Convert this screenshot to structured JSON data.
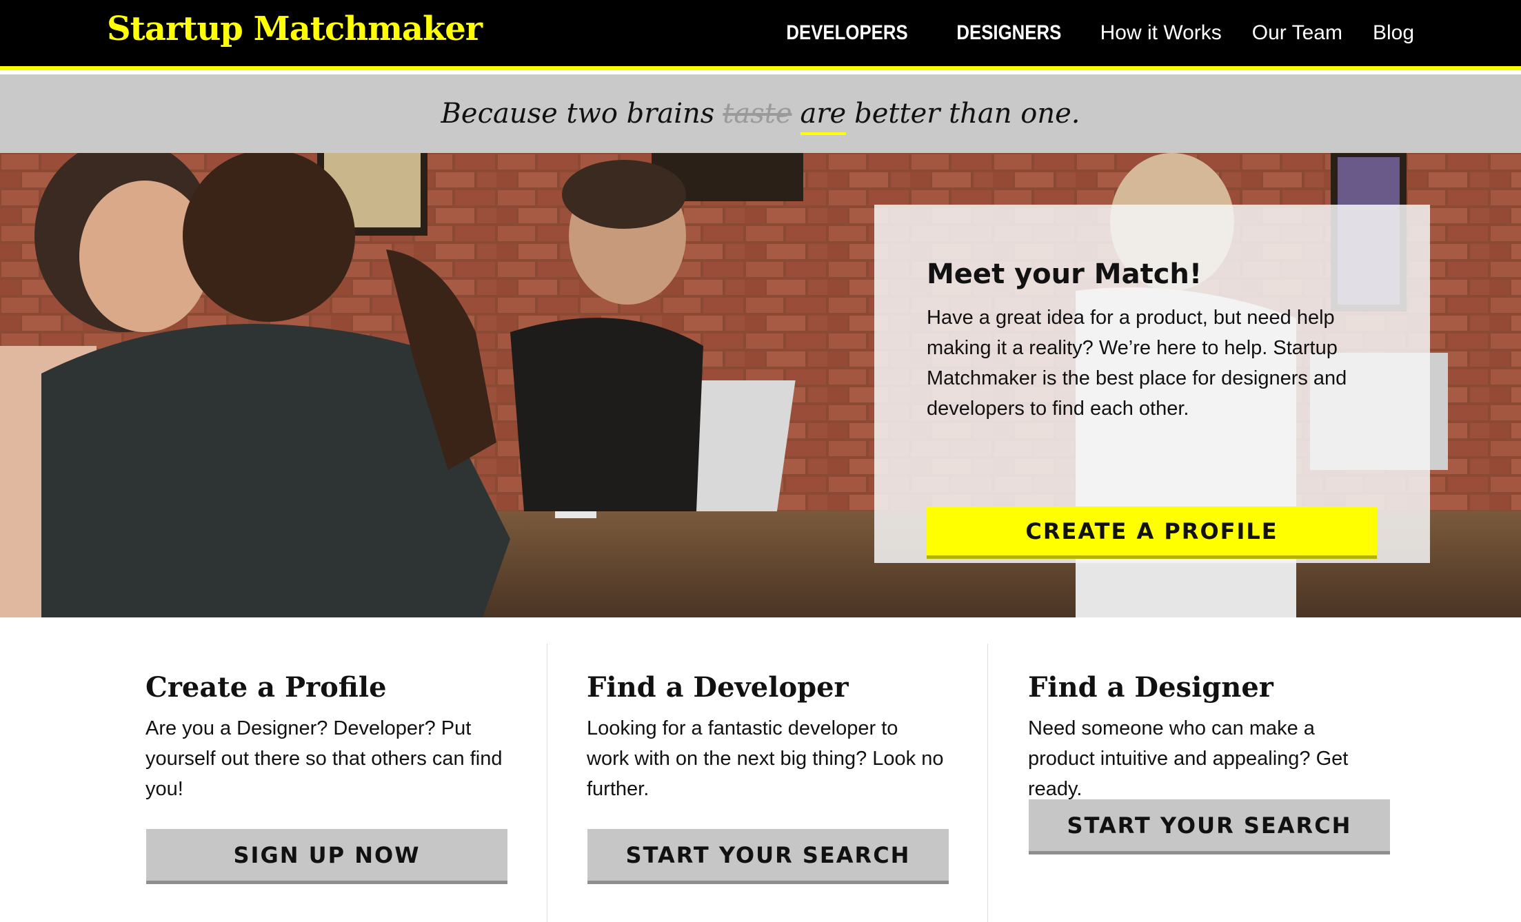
{
  "header": {
    "logo": "Startup Matchmaker",
    "nav": [
      {
        "label": "DEVELOPERS",
        "strong": true
      },
      {
        "label": "DESIGNERS",
        "strong": true
      },
      {
        "label": "How it Works",
        "strong": false
      },
      {
        "label": "Our Team",
        "strong": false
      },
      {
        "label": "Blog",
        "strong": false
      }
    ]
  },
  "tagline": {
    "lead": "Because two brains",
    "struck": "taste",
    "highlight": "are",
    "tail": "better than one."
  },
  "hero": {
    "title": "Meet your Match!",
    "body": "Have a great idea for a product, but need help making it a reality? We’re here to help. Startup Matchmaker is the best place for designers and developers to find each other.",
    "cta": "CREATE A PROFILE"
  },
  "features": [
    {
      "title": "Create a Profile",
      "body": "Are you a Designer? Developer? Put yourself out there so that others can find you!",
      "button": "SIGN UP NOW"
    },
    {
      "title": "Find a Developer",
      "body": "Looking for a fantastic developer to work with on the next big thing? Look no further.",
      "button": "START YOUR SEARCH"
    },
    {
      "title": "Find a Designer",
      "body": "Need someone who can make a product intuitive and appealing? Get ready.",
      "button": "START YOUR SEARCH"
    }
  ],
  "colors": {
    "accent": "#ffff00",
    "header_bg": "#000000",
    "tagline_bg": "#c9c9c9",
    "button_gray": "#c6c6c6"
  }
}
